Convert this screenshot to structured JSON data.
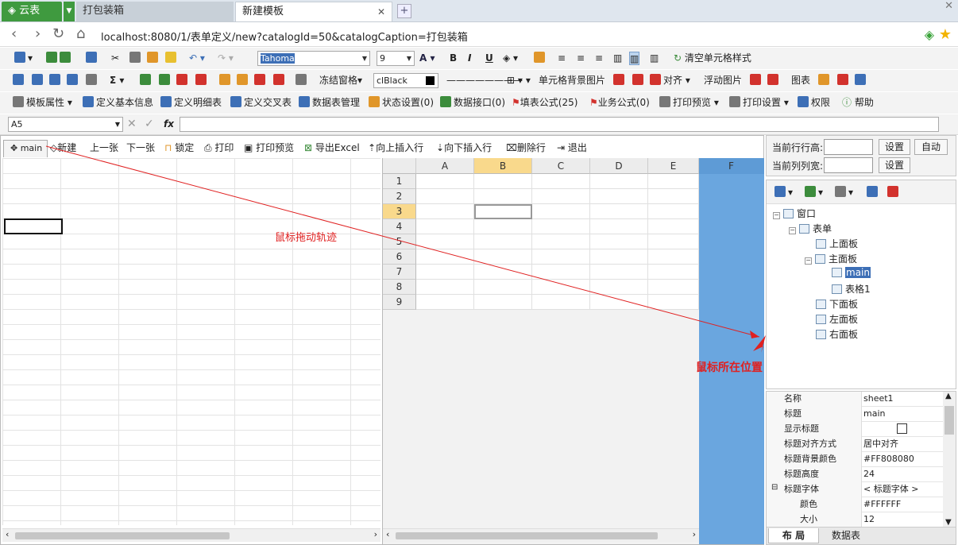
{
  "tabs": {
    "app": "云表",
    "t1": "打包装箱",
    "t2": "新建模板",
    "close": "✕",
    "new": "+"
  },
  "address": {
    "url": "localhost:8080/1/表单定义/new?catalogId=50&catalogCaption=打包装箱",
    "back": "‹",
    "fwd": "›",
    "reload": "↻",
    "home": "⌂"
  },
  "toolbar1": {
    "font": "Tahoma",
    "size": "9",
    "clear_style": "清空单元格样式"
  },
  "toolbar2": {
    "freeze": "冻结窗格",
    "color": "clBlack",
    "cell_bg": "单元格背景图片",
    "align": "对齐",
    "float_img": "浮动图片",
    "chart": "图表"
  },
  "toolbar3": {
    "items": [
      "模板属性",
      "定义基本信息",
      "定义明细表",
      "定义交叉表",
      "数据表管理",
      "状态设置(0)",
      "数据接口(0)",
      "填表公式(25)",
      "业务公式(0)",
      "打印预览",
      "打印设置",
      "权限",
      "帮助"
    ]
  },
  "formula": {
    "cell_ref": "A5",
    "fx": "fx"
  },
  "sheet_toolbar": {
    "main_tab": "main",
    "items": [
      "新建",
      "上一张",
      "下一张",
      "锁定",
      "打印",
      "打印预览",
      "导出Excel",
      "向上插入行",
      "向下插入行",
      "删除行",
      "退出"
    ]
  },
  "grid": {
    "columns": [
      "A",
      "B",
      "C",
      "D",
      "E",
      "F"
    ],
    "rows": [
      "1",
      "2",
      "3",
      "4",
      "5",
      "6",
      "7",
      "8",
      "9"
    ],
    "selected_col": "B",
    "selected_row": "3"
  },
  "row_height_panel": {
    "row_label": "当前行行高:",
    "col_label": "当前列列宽:",
    "set": "设置",
    "auto": "自动"
  },
  "tree": {
    "items": [
      "窗口",
      "表单",
      "上面板",
      "主面板",
      "main",
      "表格1",
      "下面板",
      "左面板",
      "右面板"
    ]
  },
  "properties": [
    {
      "k": "名称",
      "v": "sheet1"
    },
    {
      "k": "标题",
      "v": "main"
    },
    {
      "k": "显示标题",
      "v": ""
    },
    {
      "k": "标题对齐方式",
      "v": "居中对齐"
    },
    {
      "k": "标题背景颜色",
      "v": "#FF808080"
    },
    {
      "k": "标题高度",
      "v": "24"
    },
    {
      "k": "标题字体",
      "v": "< 标题字体 >"
    },
    {
      "k": "颜色",
      "v": "#FFFFFF"
    },
    {
      "k": "大小",
      "v": "12"
    }
  ],
  "bottom_tabs": {
    "layout": "布 局",
    "datatable": "数据表"
  },
  "annotations": {
    "drag_path": "鼠标拖动轨迹",
    "mouse_pos": "鼠标所在位置"
  },
  "colors": {
    "accent_green": "#3f9a3f",
    "selected_col": "#6aa6df",
    "annotation": "#e02020"
  }
}
